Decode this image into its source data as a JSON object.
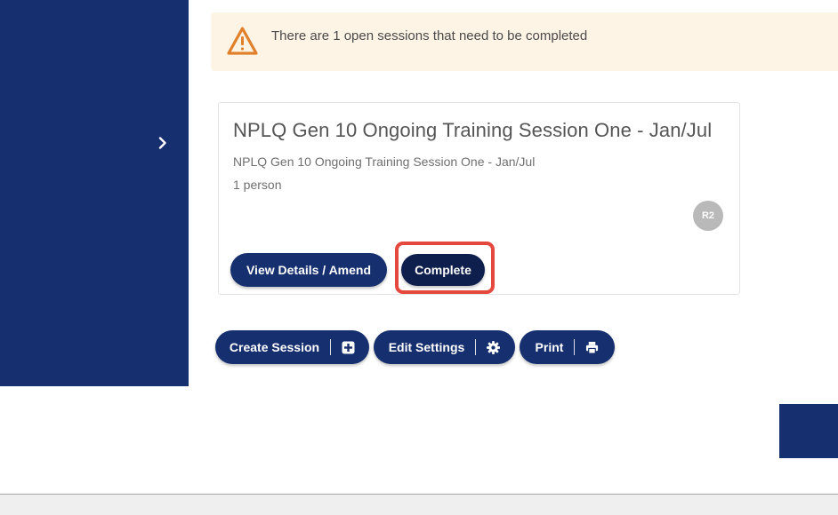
{
  "alert": {
    "message": "There are 1 open sessions that need to be completed",
    "color": "#e0802b"
  },
  "session_card": {
    "title": "NPLQ Gen 10 Ongoing Training Session One - Jan/Jul",
    "subtitle": "NPLQ Gen 10 Ongoing Training Session One - Jan/Jul",
    "people_count": "1 person",
    "avatar_initials": "R2",
    "view_button": "View Details / Amend",
    "complete_button": "Complete"
  },
  "actions": {
    "create_session": "Create Session",
    "edit_settings": "Edit Settings",
    "print": "Print"
  },
  "icons": {
    "sidebar_toggle": "chevron-right-icon",
    "alert": "warning-triangle-icon",
    "create": "plus-square-icon",
    "settings": "gear-icon",
    "print": "printer-icon"
  },
  "theme": {
    "primary": "#162f6e",
    "highlight": "#e5483d",
    "alert_background": "#fef4e6"
  }
}
